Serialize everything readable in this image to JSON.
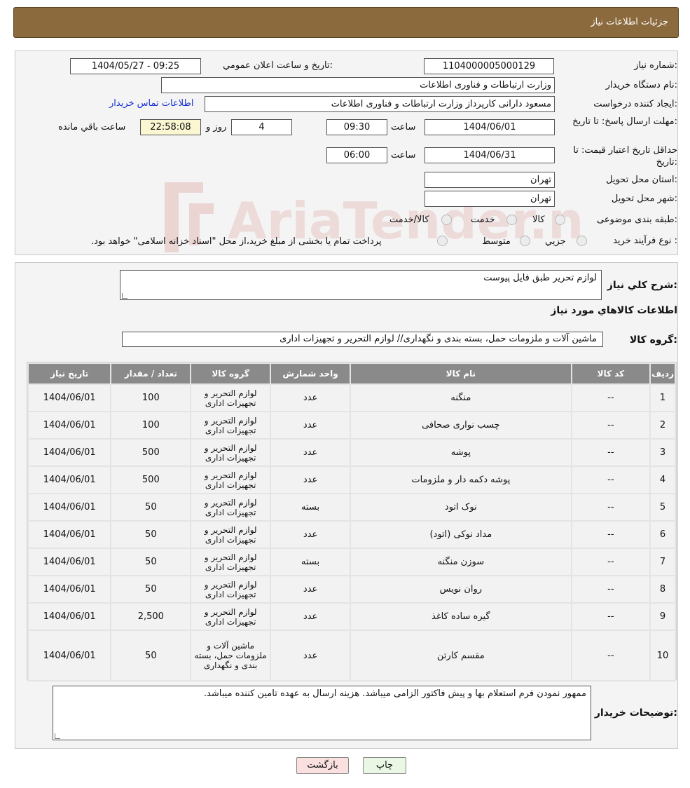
{
  "header": {
    "title": "جزئیات اطلاعات نیاز"
  },
  "form": {
    "need_number_label": "شماره نیاز:",
    "need_number": "1104000005000129",
    "announce_label": "تاریخ و ساعت اعلان عمومي:",
    "announce_value": "1404/05/27 - 09:25",
    "buyer_label": "نام دستگاه خریدار:",
    "buyer_value": "وزارت ارتباطات و فناوری اطلاعات",
    "creator_label": "ایجاد کننده درخواست:",
    "creator_value": "مسعود دارانی کارپرداز وزارت ارتباطات و فناوری اطلاعات",
    "contact_link": "اطلاعات تماس خریدار",
    "deadline_label": "مهلت ارسال پاسخ: تا تاریخ:",
    "deadline_date": "1404/06/01",
    "time_label": "ساعت",
    "deadline_time": "09:30",
    "days_value": "4",
    "days_label": "روز و",
    "remaining_value": "22:58:08",
    "remaining_label": "ساعت باقي مانده",
    "validity_label": "حداقل تاریخ اعتبار قیمت: تا تاریخ:",
    "validity_date": "1404/06/31",
    "validity_time": "06:00",
    "province_label": "استان محل تحویل:",
    "province_value": "تهران",
    "city_label": "شهر محل تحویل:",
    "city_value": "تهران",
    "category_label": "طبقه بندی موضوعی:",
    "category_options": [
      "کالا",
      "خدمت",
      "کالا/خدمت"
    ],
    "process_label": "نوع فرآیند خرید :",
    "process_options": [
      "جزیي",
      "متوسط"
    ],
    "process_note": "پرداخت تمام یا بخشی از مبلغ خرید،از محل \"اسناد خزانه اسلامی\" خواهد بود."
  },
  "details": {
    "summary_label": "شرح کلي نیاز:",
    "summary_value": "لوازم تحریر طبق فایل پیوست",
    "goods_title": "اطلاعات کالاهاي مورد نیاز",
    "group_label": "گروه کالا:",
    "group_value": "ماشین آلات و ملزومات حمل، بسته بندی و نگهداری// لوازم التحریر و تجهیزات اداری"
  },
  "table": {
    "headers": [
      "ردیف",
      "کد کالا",
      "نام کالا",
      "واحد شمارش",
      "گروه کالا",
      "تعداد / مقدار",
      "تاریخ نیاز"
    ],
    "rows": [
      [
        "1",
        "--",
        "منگنه",
        "عدد",
        "لوازم التحریر و تجهیزات اداری",
        "100",
        "1404/06/01"
      ],
      [
        "2",
        "--",
        "چسب نواری صحافی",
        "عدد",
        "لوازم التحریر و تجهیزات اداری",
        "100",
        "1404/06/01"
      ],
      [
        "3",
        "--",
        "پوشه",
        "عدد",
        "لوازم التحریر و تجهیزات اداری",
        "500",
        "1404/06/01"
      ],
      [
        "4",
        "--",
        "پوشه دکمه دار و ملزومات",
        "عدد",
        "لوازم التحریر و تجهیزات اداری",
        "500",
        "1404/06/01"
      ],
      [
        "5",
        "--",
        "نوک اتود",
        "بسته",
        "لوازم التحریر و تجهیزات اداری",
        "50",
        "1404/06/01"
      ],
      [
        "6",
        "--",
        "مداد نوکی (اتود)",
        "عدد",
        "لوازم التحریر و تجهیزات اداری",
        "50",
        "1404/06/01"
      ],
      [
        "7",
        "--",
        "سوزن منگنه",
        "بسته",
        "لوازم التحریر و تجهیزات اداری",
        "50",
        "1404/06/01"
      ],
      [
        "8",
        "--",
        "روان نویس",
        "عدد",
        "لوازم التحریر و تجهیزات اداری",
        "50",
        "1404/06/01"
      ],
      [
        "9",
        "--",
        "گیره ساده کاغذ",
        "عدد",
        "لوازم التحریر و تجهیزات اداری",
        "2,500",
        "1404/06/01"
      ],
      [
        "10",
        "--",
        "مقسم کارتن",
        "عدد",
        "ماشین آلات و ملزومات حمل، بسته بندی و نگهداری",
        "50",
        "1404/06/01"
      ]
    ]
  },
  "notes": {
    "label": "توضیحات خریدار:",
    "value": "ممهور نمودن فرم استعلام بها و پیش فاکتور الزامی میباشد. هزینه ارسال به عهده تامین کننده میباشد."
  },
  "buttons": {
    "print": "چاپ",
    "back": "بازگشت"
  },
  "watermark": {
    "text": "AriaTender.neT"
  }
}
